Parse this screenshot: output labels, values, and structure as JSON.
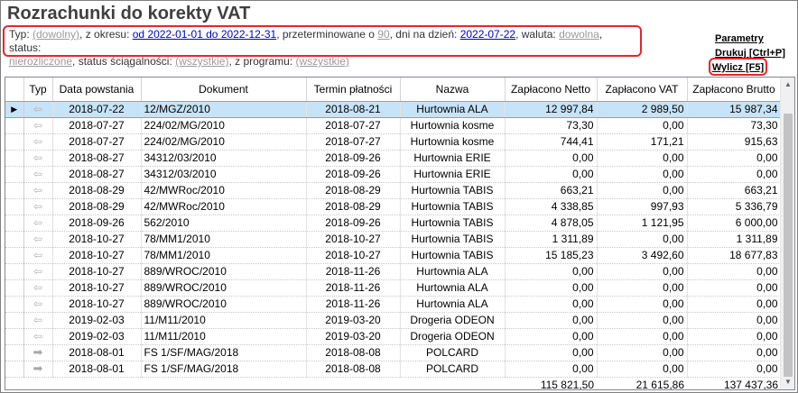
{
  "title": "Rozrachunki do korekty VAT",
  "filter": {
    "typ_prefix": "Typ: ",
    "typ_value": "(dowolny)",
    "okres_prefix": ", z okresu: ",
    "okres_value": "od 2022-01-01 do 2022-12-31",
    "przeterm_prefix": ", przeterminowane o ",
    "przeterm_value": "90",
    "dni_prefix": ", dni na dzień: ",
    "dni_value": "2022-07-22",
    "waluta_prefix": ", waluta: ",
    "waluta_value": "dowolna",
    "status_prefix": ", status: ",
    "status_value": "nierozliczone",
    "sciag_prefix": ", status ściągalności: ",
    "sciag_value": "(wszystkie)",
    "program_prefix": ", z programu: ",
    "program_value": "(wszystkie)"
  },
  "actions": {
    "params": "Parametry",
    "print": "Drukuj [Ctrl+P]",
    "calc": "Wylicz [F5]"
  },
  "columns": [
    "Typ",
    "Data powstania",
    "Dokument",
    "Termin płatności",
    "Nazwa",
    "Zapłacono Netto",
    "Zapłacono VAT",
    "Zapłacono Brutto"
  ],
  "rows": [
    {
      "icon": "left-arrow-icon",
      "data": "2018-07-22",
      "dok": "12/MGZ/2010",
      "termin": "2018-08-21",
      "nazwa": "Hurtownia ALA",
      "netto": "12 997,84",
      "vat": "2 989,50",
      "brutto": "15 987,34"
    },
    {
      "icon": "left-arrow-icon",
      "data": "2018-07-27",
      "dok": "224/02/MG/2010",
      "termin": "2018-07-27",
      "nazwa": "Hurtownia kosme",
      "netto": "73,30",
      "vat": "0,00",
      "brutto": "73,30"
    },
    {
      "icon": "left-arrow-icon",
      "data": "2018-07-27",
      "dok": "224/02/MG/2010",
      "termin": "2018-07-27",
      "nazwa": "Hurtownia kosme",
      "netto": "744,41",
      "vat": "171,21",
      "brutto": "915,63"
    },
    {
      "icon": "left-arrow-icon",
      "data": "2018-08-27",
      "dok": "34312/03/2010",
      "termin": "2018-09-26",
      "nazwa": "Hurtownia ERIE",
      "netto": "0,00",
      "vat": "0,00",
      "brutto": "0,00"
    },
    {
      "icon": "left-arrow-icon",
      "data": "2018-08-27",
      "dok": "34312/03/2010",
      "termin": "2018-09-26",
      "nazwa": "Hurtownia ERIE",
      "netto": "0,00",
      "vat": "0,00",
      "brutto": "0,00"
    },
    {
      "icon": "left-arrow-icon",
      "data": "2018-08-29",
      "dok": "42/MWRoc/2010",
      "termin": "2018-08-29",
      "nazwa": "Hurtownia TABIS",
      "netto": "663,21",
      "vat": "0,00",
      "brutto": "663,21"
    },
    {
      "icon": "left-arrow-icon",
      "data": "2018-08-29",
      "dok": "42/MWRoc/2010",
      "termin": "2018-08-29",
      "nazwa": "Hurtownia TABIS",
      "netto": "4 338,85",
      "vat": "997,93",
      "brutto": "5 336,79"
    },
    {
      "icon": "left-arrow-icon",
      "data": "2018-09-26",
      "dok": "562/2010",
      "termin": "2018-09-26",
      "nazwa": "Hurtownia TABIS",
      "netto": "4 878,05",
      "vat": "1 121,95",
      "brutto": "6 000,00"
    },
    {
      "icon": "left-arrow-icon",
      "data": "2018-10-27",
      "dok": "78/MM1/2010",
      "termin": "2018-10-27",
      "nazwa": "Hurtownia TABIS",
      "netto": "1 311,89",
      "vat": "0,00",
      "brutto": "1 311,89"
    },
    {
      "icon": "left-arrow-icon",
      "data": "2018-10-27",
      "dok": "78/MM1/2010",
      "termin": "2018-10-27",
      "nazwa": "Hurtownia TABIS",
      "netto": "15 185,23",
      "vat": "3 492,60",
      "brutto": "18 677,83"
    },
    {
      "icon": "left-arrow-icon",
      "data": "2018-10-27",
      "dok": "889/WROC/2010",
      "termin": "2018-11-26",
      "nazwa": "Hurtownia ALA",
      "netto": "0,00",
      "vat": "0,00",
      "brutto": "0,00"
    },
    {
      "icon": "left-arrow-icon",
      "data": "2018-10-27",
      "dok": "889/WROC/2010",
      "termin": "2018-11-26",
      "nazwa": "Hurtownia ALA",
      "netto": "0,00",
      "vat": "0,00",
      "brutto": "0,00"
    },
    {
      "icon": "left-arrow-icon",
      "data": "2018-10-27",
      "dok": "889/WROC/2010",
      "termin": "2018-11-26",
      "nazwa": "Hurtownia ALA",
      "netto": "0,00",
      "vat": "0,00",
      "brutto": "0,00"
    },
    {
      "icon": "left-arrow-icon",
      "data": "2019-02-03",
      "dok": "11/M11/2010",
      "termin": "2019-03-20",
      "nazwa": "Drogeria ODEON",
      "netto": "0,00",
      "vat": "0,00",
      "brutto": "0,00"
    },
    {
      "icon": "left-arrow-icon",
      "data": "2019-02-03",
      "dok": "11/M11/2010",
      "termin": "2019-03-20",
      "nazwa": "Drogeria ODEON",
      "netto": "0,00",
      "vat": "0,00",
      "brutto": "0,00"
    },
    {
      "icon": "right-arrow-icon",
      "data": "2018-08-01",
      "dok": "FS 1/SF/MAG/2018",
      "termin": "2018-08-08",
      "nazwa": "POLCARD",
      "netto": "0,00",
      "vat": "0,00",
      "brutto": "0,00"
    },
    {
      "icon": "right-arrow-icon",
      "data": "2018-08-01",
      "dok": "FS 1/SF/MAG/2018",
      "termin": "2018-08-08",
      "nazwa": "POLCARD",
      "netto": "0,00",
      "vat": "0,00",
      "brutto": "0,00"
    }
  ],
  "totals": {
    "netto": "115 821,50",
    "vat": "21 615,86",
    "brutto": "137 437,36"
  },
  "selected_row_indicator": "▶"
}
